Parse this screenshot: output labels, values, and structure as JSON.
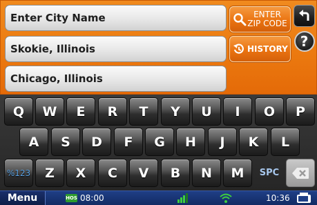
{
  "search": {
    "city_field": "Enter City Name",
    "recent_1": "Skokie, Illinois",
    "recent_2": "Chicago, Illinois"
  },
  "buttons": {
    "zip_line1": "ENTER",
    "zip_line2": "ZIP CODE",
    "history": "HISTORY",
    "help": "?"
  },
  "keyboard": {
    "row1": [
      "Q",
      "W",
      "E",
      "R",
      "T",
      "Y",
      "U",
      "I",
      "O",
      "P"
    ],
    "row2": [
      "A",
      "S",
      "D",
      "F",
      "G",
      "H",
      "J",
      "K",
      "L"
    ],
    "row3": [
      "%123",
      "Z",
      "X",
      "C",
      "V",
      "B",
      "N",
      "M",
      "SPC"
    ]
  },
  "status": {
    "menu": "Menu",
    "hos_badge": "HOS",
    "hos_time": "08:00",
    "clock": "10:36"
  },
  "colors": {
    "accent": "#ec7a10",
    "status_bar": "#1a3676",
    "keyboard_bg": "#262626"
  },
  "icons": {
    "zip": "search-icon",
    "history": "history-icon",
    "back": "back-arrow-icon",
    "help": "help-icon",
    "backspace": "backspace-icon",
    "signal": "signal-icon",
    "wifi": "wifi-icon",
    "device": "device-icon"
  }
}
